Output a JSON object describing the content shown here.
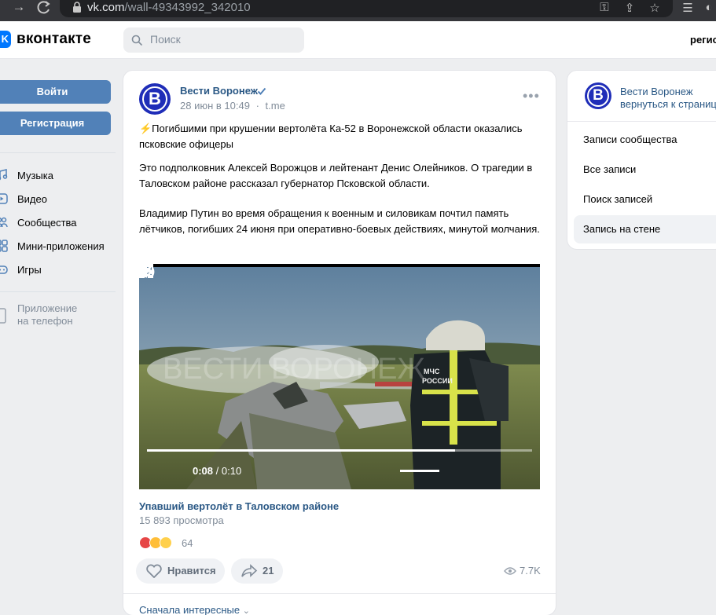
{
  "browser": {
    "url_host": "vk.com",
    "url_path": "/wall-49343992_342010"
  },
  "header": {
    "logo_text": "вконтакте",
    "search_placeholder": "Поиск",
    "register_link": "регис"
  },
  "sidebar": {
    "login_button": "Войти",
    "register_button": "Регистрация",
    "items": [
      {
        "label": "Музыка",
        "icon": "music-icon"
      },
      {
        "label": "Видео",
        "icon": "video-icon"
      },
      {
        "label": "Сообщества",
        "icon": "communities-icon"
      },
      {
        "label": "Мини-приложения",
        "icon": "mini-apps-icon"
      },
      {
        "label": "Игры",
        "icon": "games-icon"
      }
    ],
    "app_line1": "Приложение",
    "app_line2": "на телефон"
  },
  "post": {
    "author": "Вести Воронеж",
    "date": "28 июн в 10:49",
    "source": "t.me",
    "paragraphs": [
      "⚡Погибшими при крушении вертолёта Ка-52 в Воронежской области оказались псковские офицеры",
      "Это подполковник Алексей Ворожцов и лейтенант Денис Олейников. О трагедии в Таловском районе рассказал губернатор Псковской области.",
      "Владимир Путин во время обращения к военным и силовикам почтил память лётчиков, погибших 24 июня при оперативно-боевых действиях, минутой молчания."
    ],
    "video": {
      "watermark": "ВЕСТИ ВОРОНЕЖ",
      "current_time": "0:08",
      "total_time": "/ 0:10",
      "progress": 0.8,
      "volume": 1.0,
      "title": "Упавший вертолёт в Таловском районе",
      "views": "15 893 просмотра"
    },
    "reactions_count": "64",
    "like_label": "Нравится",
    "share_count": "21",
    "views_count": "7.7K",
    "sort_label": "Сначала интересные"
  },
  "right_panel": {
    "name": "Вести Воронеж",
    "back_link": "вернуться к странице",
    "items": [
      {
        "label": "Записи сообщества",
        "active": false
      },
      {
        "label": "Все записи",
        "active": false
      },
      {
        "label": "Поиск записей",
        "active": false
      },
      {
        "label": "Запись на стене",
        "active": true
      }
    ]
  },
  "colors": {
    "vk_blue": "#0077ff",
    "button_blue": "#5181b8",
    "link_blue": "#2a5885",
    "avatar_blue": "#1f2db8"
  }
}
